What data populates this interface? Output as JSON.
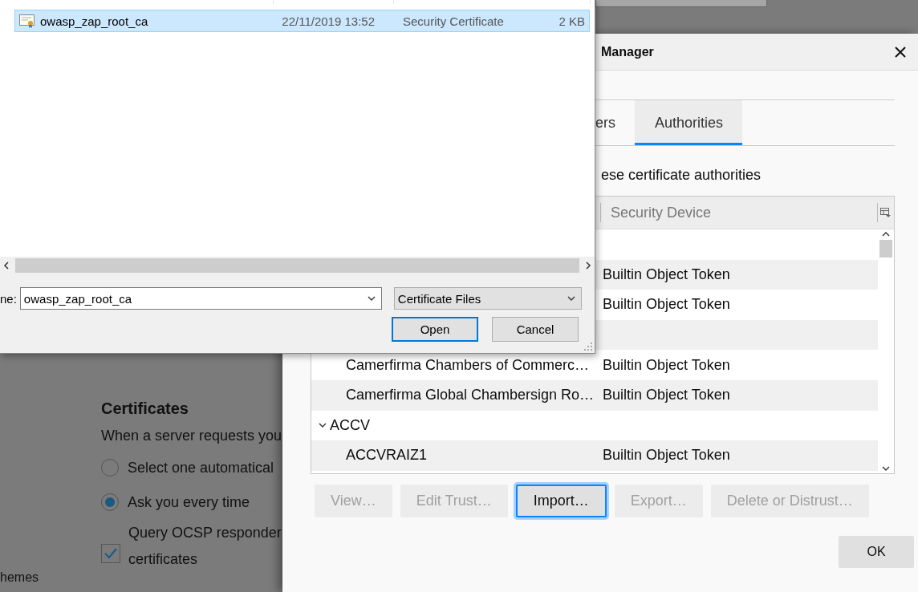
{
  "background_page": {
    "heading": "Certificates",
    "description": "When a server requests you",
    "options": [
      {
        "label": "Select one automatical",
        "selected": false
      },
      {
        "label": "Ask you every time",
        "selected": true
      }
    ],
    "ocsp_checkbox": {
      "label_lines": [
        "Query OCSP responder",
        "certificates"
      ],
      "checked": true
    },
    "sidebar_item": "hemes"
  },
  "certificate_manager": {
    "title": "Manager",
    "tabs": [
      {
        "label": "ers",
        "selected": false
      },
      {
        "label": "Authorities",
        "selected": true
      }
    ],
    "intro": "ese certificate authorities",
    "columns": [
      "Security Device"
    ],
    "rows": [
      {
        "kind": "group"
      },
      {
        "kind": "cert",
        "device": "Builtin Object Token"
      },
      {
        "kind": "cert",
        "device": "Builtin Object Token"
      },
      {
        "kind": "group"
      },
      {
        "kind": "cert",
        "name": "Camerfirma Chambers of Commerc…",
        "device": "Builtin Object Token"
      },
      {
        "kind": "cert",
        "name": "Camerfirma Global Chambersign Ro…",
        "device": "Builtin Object Token"
      },
      {
        "kind": "group",
        "name": "ACCV",
        "expanded": true
      },
      {
        "kind": "cert",
        "name": "ACCVRAIZ1",
        "device": "Builtin Object Token"
      }
    ],
    "buttons": [
      {
        "label": "View…",
        "disabled": true,
        "focused": false
      },
      {
        "label": "Edit Trust…",
        "disabled": true,
        "focused": false
      },
      {
        "label": "Import…",
        "disabled": false,
        "focused": true
      },
      {
        "label": "Export…",
        "disabled": true,
        "focused": false
      },
      {
        "label": "Delete or Distrust…",
        "disabled": true,
        "focused": false
      }
    ],
    "ok_button": "OK"
  },
  "file_dialog": {
    "files": [
      {
        "name": "owasp_zap_root_ca",
        "modified": "22/11/2019 13:52",
        "type": "Security Certificate",
        "size": "2 KB",
        "selected": true
      }
    ],
    "filename_label": "ne:",
    "filename": "owasp_zap_root_ca",
    "filter": "Certificate Files",
    "buttons": [
      {
        "label": "Open",
        "default": true
      },
      {
        "label": "Cancel",
        "default": false
      }
    ]
  }
}
